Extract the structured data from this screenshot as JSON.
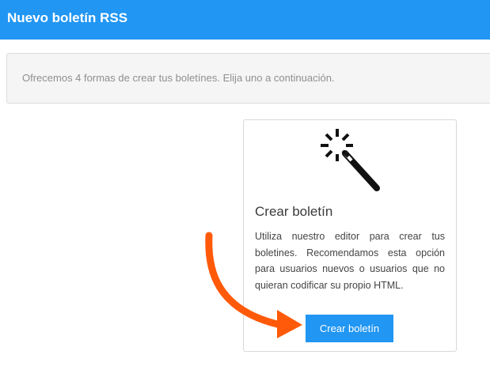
{
  "header": {
    "title": "Nuevo boletín RSS"
  },
  "info": {
    "text": "Ofrecemos 4 formas de crear tus boletínes. Elija uno a continuación."
  },
  "card": {
    "icon": "magic-wand-icon",
    "title": "Crear boletín",
    "description": "Utiliza nuestro editor para crear tus boletines. Recomendamos esta opción para usuarios nuevos o usuarios que no quieran codificar su propio HTML.",
    "button_label": "Crear boletín"
  },
  "annotation": {
    "icon": "arrow-annotation-icon",
    "color": "#ff5a0a"
  },
  "colors": {
    "accent": "#2196f3",
    "info_background": "#f5f5f5"
  }
}
